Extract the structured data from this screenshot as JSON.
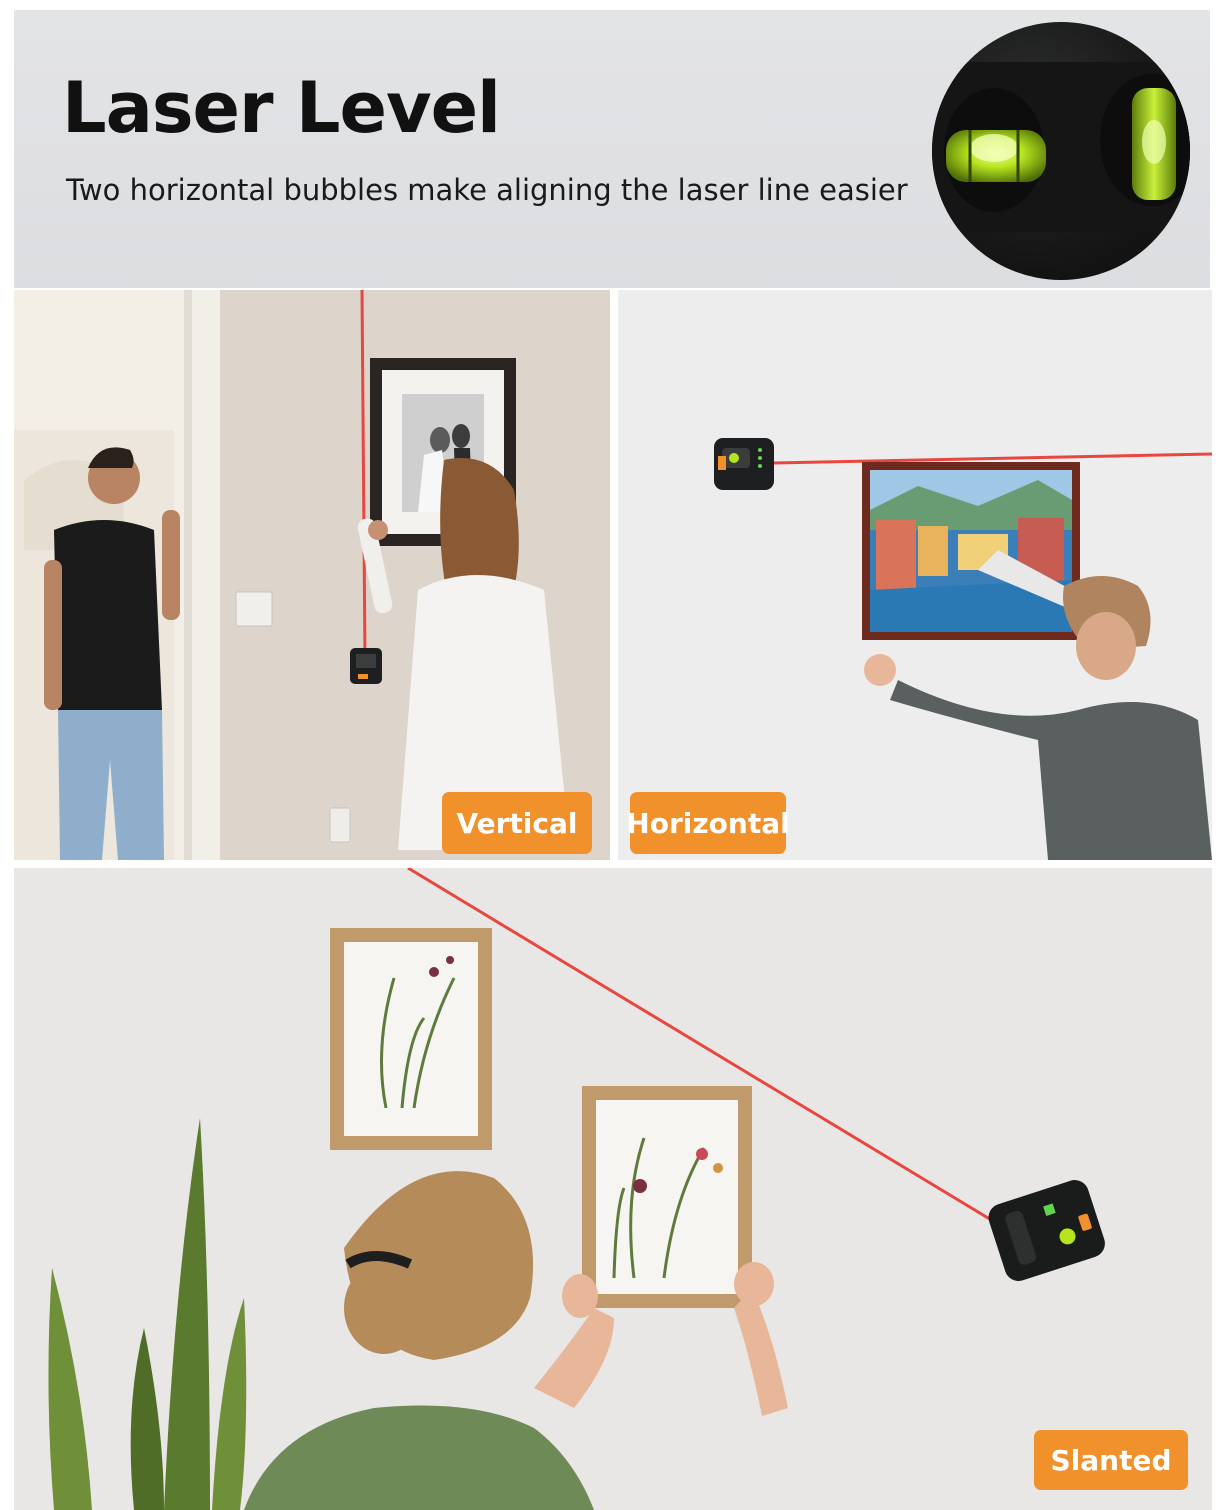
{
  "header": {
    "title": "Laser Level",
    "subtitle": "Two horizontal bubbles make aligning the laser line easier"
  },
  "panels": {
    "vertical": {
      "label": "Vertical"
    },
    "horizontal": {
      "label": "Horizontal"
    },
    "slanted": {
      "label": "Slanted"
    }
  },
  "colors": {
    "tag_orange": "#f0912c",
    "laser_red": "#e8473f",
    "bubble_green": "#b6e51f"
  },
  "icons": {
    "bubble_level": "level-bubble-icon",
    "laser_device": "laser-level-device-icon"
  }
}
